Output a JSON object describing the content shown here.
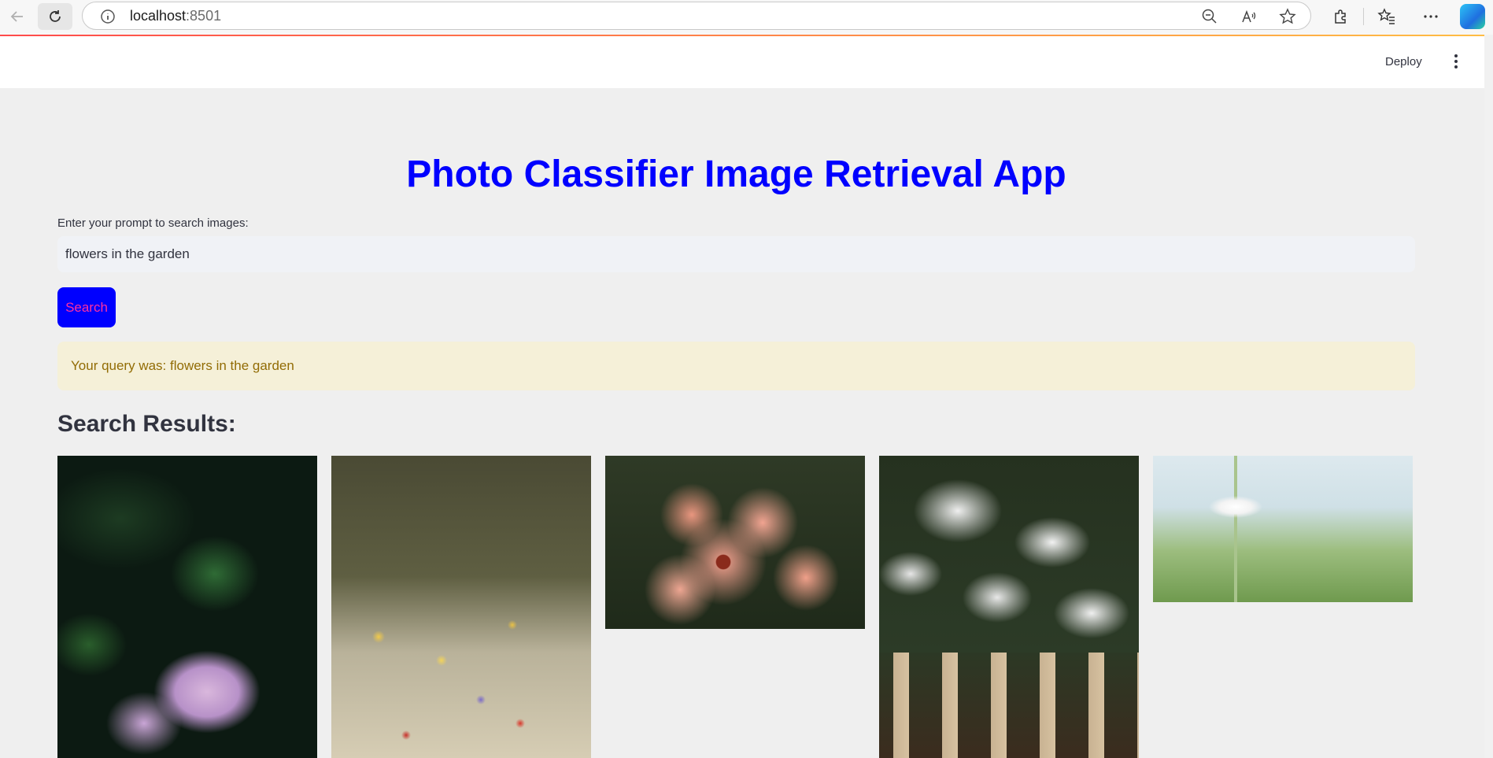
{
  "browser": {
    "url_host": "localhost",
    "url_port": ":8501"
  },
  "header": {
    "deploy_label": "Deploy"
  },
  "main": {
    "title": "Photo Classifier Image Retrieval App",
    "prompt_label": "Enter your prompt to search images:",
    "search_value": "flowers in the garden",
    "search_button_label": "Search",
    "query_message": "Your query was: flowers in the garden",
    "results_heading": "Search Results:"
  },
  "colors": {
    "title": "#0000ff",
    "button_bg": "#0000ff",
    "button_text": "#ff2fa0",
    "query_bg": "#f5f0d8",
    "query_text": "#926c05"
  },
  "results": [
    {
      "image": "hydrangea"
    },
    {
      "image": "wildflower-meadow"
    },
    {
      "image": "coneflowers"
    },
    {
      "image": "white-flowers-balustrade"
    },
    {
      "image": "daisy-in-grass"
    }
  ]
}
